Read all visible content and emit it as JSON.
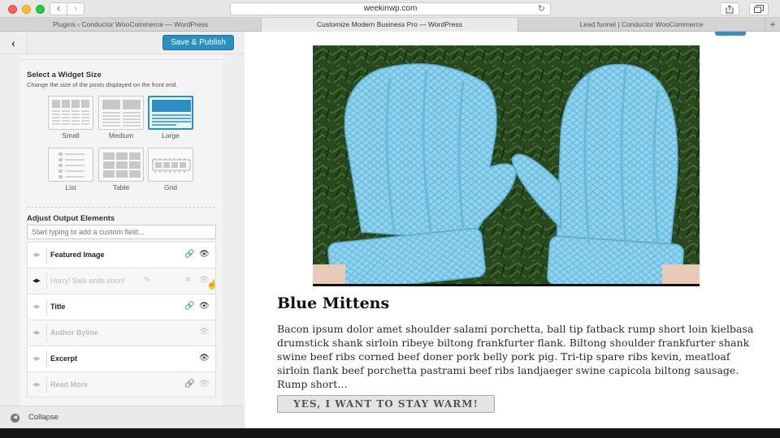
{
  "browser": {
    "url": "weekinwp.com",
    "tabs": [
      "Plugins ‹ Conductor WooCommerce — WordPress",
      "Customize Modern Business Pro — WordPress",
      "Lead funnel | Conductor WooCommerce"
    ],
    "new_tab": "+"
  },
  "customizer": {
    "save_label": "Save & Publish",
    "widget_size": {
      "title": "Select a Widget Size",
      "description": "Change the size of the posts displayed on the front end.",
      "options": [
        "Small",
        "Medium",
        "Large",
        "List",
        "Table",
        "Grid"
      ],
      "selected": "Large"
    },
    "output": {
      "title": "Adjust Output Elements",
      "placeholder": "Start typing to add a custom field...",
      "elements": [
        {
          "label": "Featured Image",
          "enabled": true
        },
        {
          "label": "Hurry! Sale ends soon!",
          "enabled": false
        },
        {
          "label": "Title",
          "enabled": true
        },
        {
          "label": "Author Byline",
          "enabled": false
        },
        {
          "label": "Excerpt",
          "enabled": true
        },
        {
          "label": "Read More",
          "enabled": false
        }
      ]
    },
    "collapse_label": "Collapse"
  },
  "preview": {
    "product_title": "Blue Mittens",
    "description": "Bacon ipsum dolor amet shoulder salami porchetta, ball tip fatback rump short loin kielbasa drumstick shank sirloin ribeye biltong frankfurter flank. Biltong shoulder frankfurter shank swine beef ribs corned beef doner pork belly pork pig. Tri-tip spare ribs kevin, meatloaf sirloin flank beef porchetta pastrami beef ribs landjaeger swine capicola biltong sausage. Rump short…",
    "cta_label": "YES, I WANT TO STAY WARM!"
  },
  "colors": {
    "accent": "#2b8fc3",
    "mitten": "#8fd3ee"
  }
}
